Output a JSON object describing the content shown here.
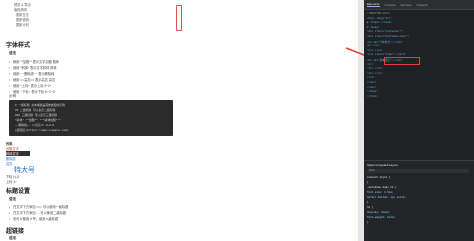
{
  "toc": [
    "预览 & 导出",
    "版权声明",
    "更新日志",
    "更新说明",
    "更新计划"
  ],
  "sections": {
    "font_style": "字体样式",
    "basic_syntax": "基本语法",
    "title_settings": "标题设置",
    "hyperlink": "超链接"
  },
  "font_sub": "语法",
  "font_bullets": [
    "使用 **加粗** 表示文字加粗 粗体",
    "使用 *斜体* 表示文字斜体 斜体",
    "使用 ~~删除线~~ 表示删除线",
    "使用 ==高亮== 表示高亮 高亮",
    "使用 ^上标^ 表示上标 X^2^",
    "使用 ~下标~ 表示下标 H~2~O"
  ],
  "example_label": "示例",
  "code_lines": [
    "# 一级标题 文本或者是其他类型的示例",
    "## 二级标题 可以表示二级标题",
    "### 三级标题 可以表示三级标题",
    "*斜体* **加粗** ***斜体加粗***",
    "~~删除线~~ ==高亮== H~2~O",
    "[超链接](https://www.example.com)"
  ],
  "render_lines": [
    "效果",
    "加粗文字",
    "斜体文字",
    "删除线",
    "高亮",
    "特大号",
    "下标 H₂O",
    "上标 X²"
  ],
  "title_bullets": [
    "在文字下方添加 === 可以使用一级标题",
    "在文字下方添加 --- 可以使用二级标题",
    "也可以使用 # 号，最多六级标题"
  ],
  "devtools": {
    "tabs": [
      "Elements",
      "Console",
      "Sources",
      "Network"
    ],
    "lines": [
      {
        "text": "<!DOCTYPE html>",
        "color": "#9aa0a6"
      },
      {
        "text": "<html lang=\"zh\">",
        "color": "#5db0d7"
      },
      {
        "text": "▶ <head>…</head>",
        "color": "#5db0d7"
      },
      {
        "text": "▼ <body>",
        "color": "#5db0d7"
      },
      {
        "text": "  <div class=\"container\">",
        "color": "#5db0d7"
      },
      {
        "text": "   <div class=\"markdown-body\">",
        "color": "#5db0d7"
      },
      {
        "text": "    <h2 id=\"字体样式\">…</h2>",
        "color": "#5db0d7"
      },
      {
        "text": "    <p>…</p>",
        "color": "#5db0d7"
      },
      {
        "text": "    <ul>…</ul>",
        "color": "#5db0d7"
      },
      {
        "text": "    <pre class=\"code\">…</pre>",
        "color": "#5db0d7"
      },
      {
        "text": "    <h2 id=\"基本语法\">…</h2>",
        "color": "#5db0d7"
      },
      {
        "text": "    <ul>",
        "color": "#5db0d7"
      },
      {
        "text": "     <li>…</li>",
        "color": "#5db0d7"
      },
      {
        "text": "     <li>…</li>",
        "color": "#5db0d7"
      },
      {
        "text": "    </ul>",
        "color": "#5db0d7"
      },
      {
        "text": "   </div>",
        "color": "#5db0d7"
      },
      {
        "text": "  </div>",
        "color": "#5db0d7"
      },
      {
        "text": " </body>",
        "color": "#5db0d7"
      },
      {
        "text": "</html>",
        "color": "#5db0d7"
      }
    ],
    "styles_header": "Styles  Computed  Layout",
    "styles_filter": "Filter",
    "style_rules": [
      "element.style {",
      "}",
      ".markdown-body h2 {",
      "  font-size: 1.5em;",
      "  border-bottom: 1px solid;",
      "}",
      "h2 {",
      "  display: block;",
      "  font-weight: bold;",
      "}"
    ]
  },
  "colors": {
    "accent_red": "#e0413a",
    "devtools_bg": "#202124",
    "link_blue": "#2a6fd6"
  }
}
